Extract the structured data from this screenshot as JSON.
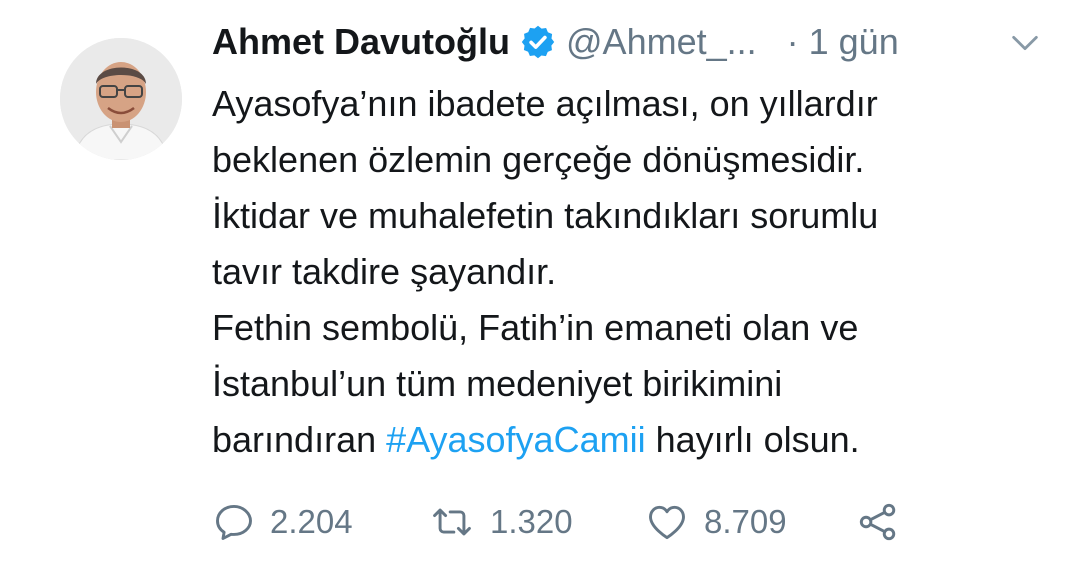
{
  "tweet": {
    "author_name": "Ahmet Davutoğlu",
    "handle": "@Ahmet_...",
    "time": "· 1 gün",
    "text_lines": [
      "Ayasofya’nın ibadete açılması, on yıllardır",
      "beklenen özlemin gerçeğe dönüşmesidir.",
      "İktidar ve muhalefetin takındıkları sorumlu",
      "tavır takdire şayandır.",
      "Fethin sembolü, Fatih’in emaneti olan ve",
      "İstanbul’un tüm medeniyet birikimini"
    ],
    "last_line_prefix": "barındıran ",
    "hashtag": "#AyasofyaCamii",
    "last_line_suffix": " hayırlı olsun."
  },
  "actions": {
    "reply_count": "2.204",
    "retweet_count": "1.320",
    "like_count": "8.709"
  },
  "icons": {
    "verified": "verified-badge-icon",
    "menu": "chevron-down-icon",
    "reply": "reply-bubble-icon",
    "retweet": "retweet-icon",
    "like": "heart-icon",
    "share": "share-icon"
  },
  "colors": {
    "text": "#14171a",
    "secondary": "#657786",
    "accent": "#1da1f2"
  }
}
